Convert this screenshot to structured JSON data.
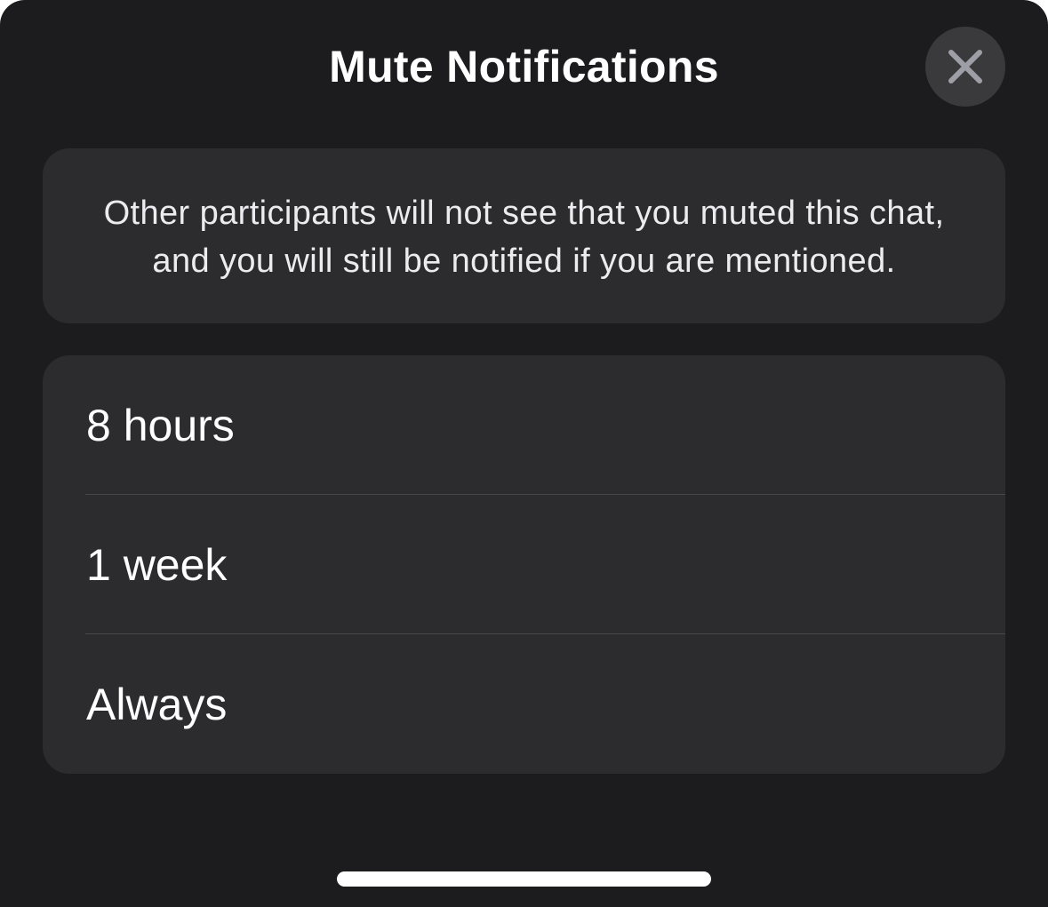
{
  "sheet": {
    "title": "Mute Notifications",
    "close_icon": "close-icon",
    "info_text": "Other participants will not see that you muted this chat, and you will still be notified if you are mentioned."
  },
  "options": [
    {
      "label": "8 hours"
    },
    {
      "label": "1 week"
    },
    {
      "label": "Always"
    }
  ],
  "colors": {
    "sheet_background": "#1c1c1e",
    "card_background": "#2c2c2e",
    "close_button_background": "#3a3a3c",
    "close_icon_color": "#9e9ea6",
    "text_primary": "#ffffff"
  }
}
